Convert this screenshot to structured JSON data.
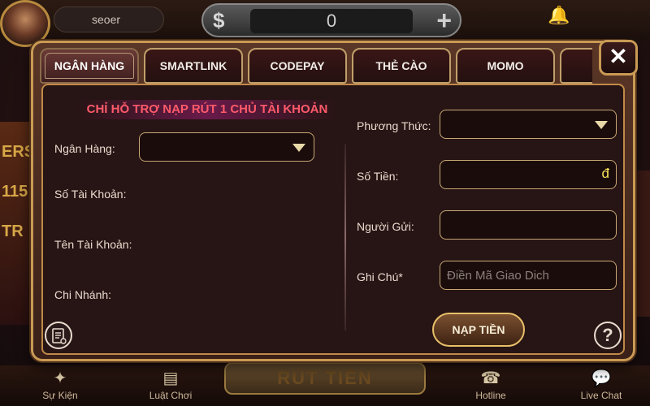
{
  "lobby": {
    "username": "seoer",
    "balance": "0",
    "bell_label": "Tin Tức",
    "bottom_nav": [
      {
        "label": "Sự Kiện",
        "icon": "party-icon"
      },
      {
        "label": "Luật Chơi",
        "icon": "rules-icon"
      },
      {
        "label": "Hotline",
        "icon": "phone-icon"
      },
      {
        "label": "Live Chat",
        "icon": "chat-icon"
      }
    ],
    "withdraw_label": "RÚT TIỀN",
    "side_labels": [
      "ERS",
      "115",
      "TR"
    ]
  },
  "modal": {
    "tabs": [
      {
        "label": "NGÂN HÀNG",
        "active": true
      },
      {
        "label": "SMARTLINK",
        "active": false
      },
      {
        "label": "CODEPAY",
        "active": false
      },
      {
        "label": "THẺ CÀO",
        "active": false
      },
      {
        "label": "MOMO",
        "active": false
      }
    ],
    "close_label": "✕",
    "notice": "CHỈ HỖ TRỢ NẠP RÚT 1 CHỦ TÀI KHOẢN",
    "left": {
      "bank_label": "Ngân Hàng:",
      "bank_value": "",
      "account_number_label": "Số Tài Khoản:",
      "account_name_label": "Tên Tài Khoản:",
      "branch_label": "Chi Nhánh:"
    },
    "right": {
      "method_label": "Phương Thức:",
      "method_value": "",
      "amount_label": "Số Tiền:",
      "amount_value": "",
      "currency_symbol": "đ",
      "sender_label": "Người Gửi:",
      "sender_value": "",
      "note_label": "Ghi Chú*",
      "note_placeholder": "Điền Mã Giao Dich"
    },
    "submit_label": "NẠP TIỀN",
    "help_label": "?"
  }
}
